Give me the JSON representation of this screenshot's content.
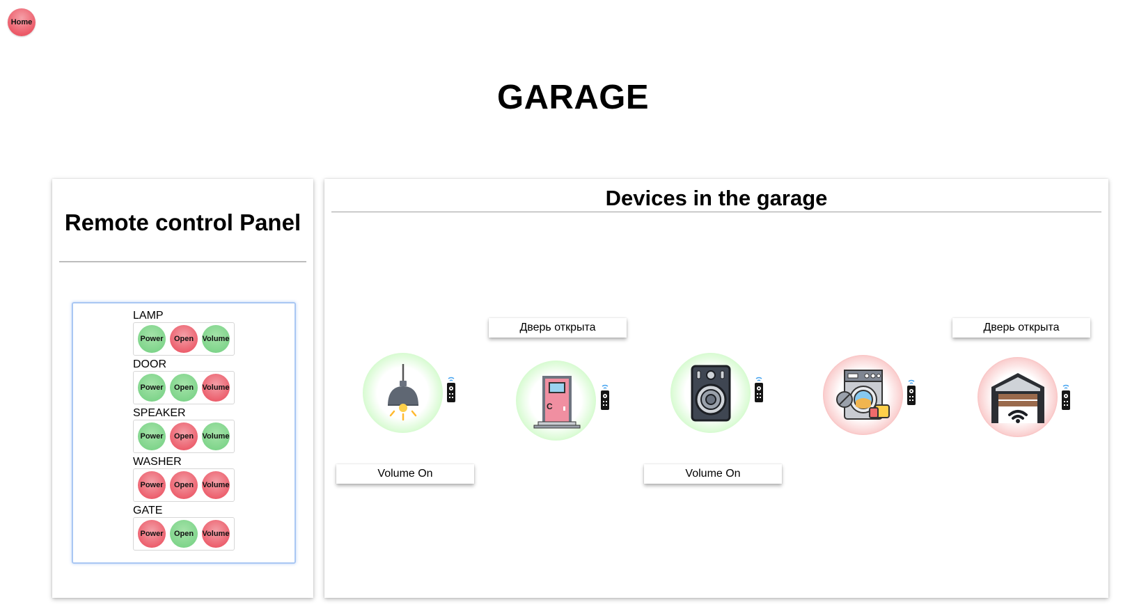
{
  "nav": {
    "home_label": "Home"
  },
  "page": {
    "title": "GARAGE"
  },
  "remote_panel": {
    "title": "Remote control Panel",
    "devices": [
      {
        "name": "LAMP",
        "buttons": [
          {
            "label": "Power",
            "state": "on"
          },
          {
            "label": "Open",
            "state": "off"
          },
          {
            "label": "Volume",
            "state": "on"
          }
        ]
      },
      {
        "name": "DOOR",
        "buttons": [
          {
            "label": "Power",
            "state": "on"
          },
          {
            "label": "Open",
            "state": "on"
          },
          {
            "label": "Volume",
            "state": "off"
          }
        ]
      },
      {
        "name": "SPEAKER",
        "buttons": [
          {
            "label": "Power",
            "state": "on"
          },
          {
            "label": "Open",
            "state": "off"
          },
          {
            "label": "Volume",
            "state": "on"
          }
        ]
      },
      {
        "name": "WASHER",
        "buttons": [
          {
            "label": "Power",
            "state": "off"
          },
          {
            "label": "Open",
            "state": "off"
          },
          {
            "label": "Volume",
            "state": "off"
          }
        ]
      },
      {
        "name": "GATE",
        "buttons": [
          {
            "label": "Power",
            "state": "off"
          },
          {
            "label": "Open",
            "state": "on"
          },
          {
            "label": "Volume",
            "state": "off"
          }
        ]
      }
    ]
  },
  "devices_panel": {
    "title": "Devices in the garage",
    "devices": [
      {
        "name": "lamp",
        "icon": "lamp-icon",
        "power": "on",
        "status_top": "",
        "status_bottom": "Volume On"
      },
      {
        "name": "door",
        "icon": "door-icon",
        "power": "on",
        "status_top": "Дверь открыта",
        "status_bottom": ""
      },
      {
        "name": "speaker",
        "icon": "speaker-icon",
        "power": "on",
        "status_top": "",
        "status_bottom": "Volume On"
      },
      {
        "name": "washer",
        "icon": "washer-icon",
        "power": "off",
        "status_top": "",
        "status_bottom": ""
      },
      {
        "name": "gate",
        "icon": "garage-gate-icon",
        "power": "off",
        "status_top": "Дверь открыта",
        "status_bottom": ""
      }
    ]
  },
  "colors": {
    "on": "#7ed48a",
    "off": "#ec5d6b",
    "glow_on": "#72f060",
    "glow_off": "#ee2a2a",
    "panel_border": "#a9c7f3"
  }
}
